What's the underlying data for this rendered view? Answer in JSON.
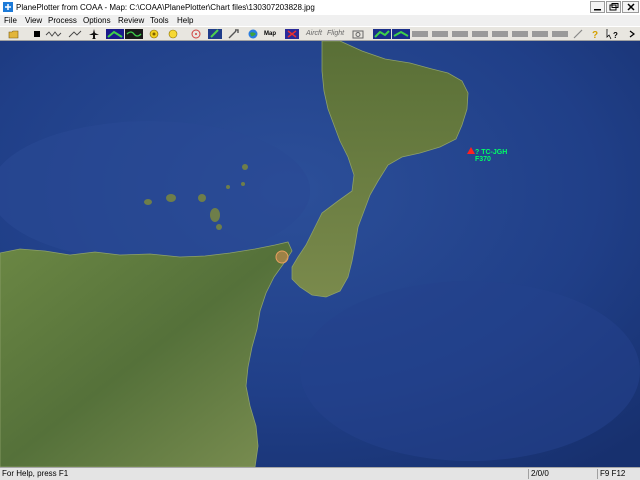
{
  "window": {
    "title": "PlanePlotter from COAA - Map: C:\\COAA\\PlanePlotter\\Chart files\\130307203828.jpg"
  },
  "menu": [
    "File",
    "View",
    "Process",
    "Options",
    "Review",
    "Tools",
    "Help"
  ],
  "toolbar": {
    "text_buttons": [
      "Map",
      "Aircft",
      "Flight"
    ]
  },
  "aircraft": [
    {
      "callsign": "? TC-JGH",
      "flight_level": "F370",
      "marker_color": "#ff2020"
    }
  ],
  "status": {
    "help_text": "For Help, press F1",
    "count_text": "2/0/0",
    "keys_text": "F9 F12"
  },
  "colors": {
    "sea_deep": "#1a357a",
    "sea_shallow": "#2c4f99",
    "land": "#5f7a3d",
    "label_green": "#00ff66"
  }
}
